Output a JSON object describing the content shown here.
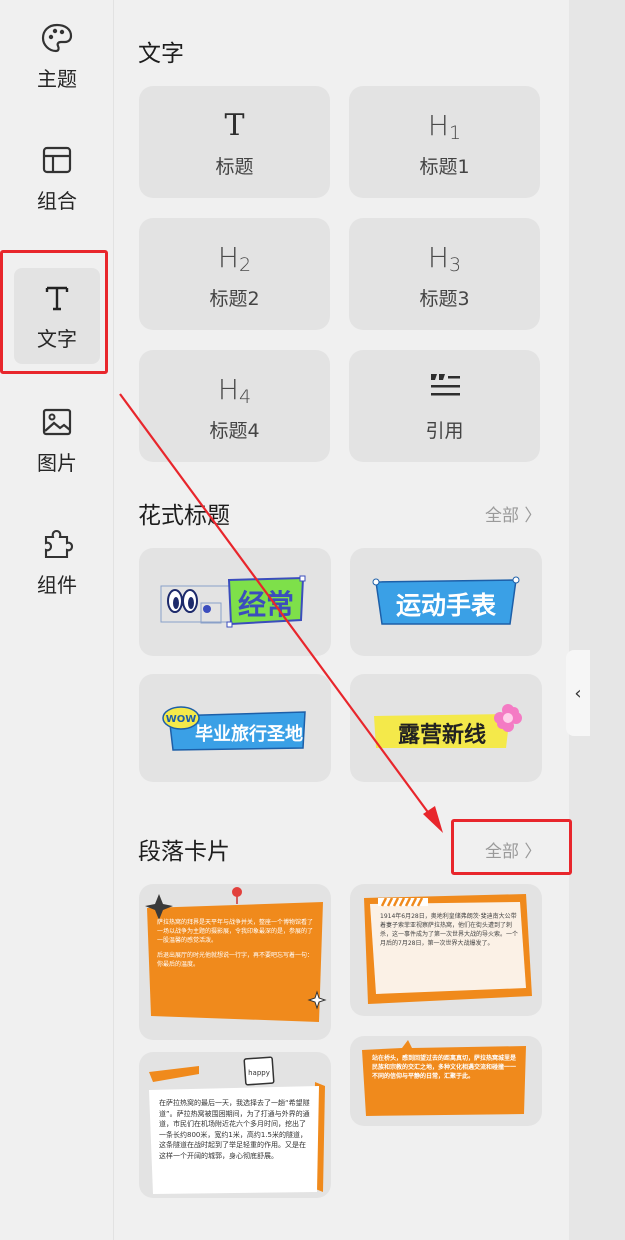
{
  "sidebar": {
    "items": [
      {
        "label": "主题",
        "icon": "palette-icon",
        "active": false
      },
      {
        "label": "组合",
        "icon": "layout-icon",
        "active": false
      },
      {
        "label": "文字",
        "icon": "text-icon",
        "active": true
      },
      {
        "label": "图片",
        "icon": "image-icon",
        "active": false
      },
      {
        "label": "组件",
        "icon": "puzzle-icon",
        "active": false
      }
    ]
  },
  "text_section": {
    "title": "文字",
    "tiles": [
      {
        "glyph": "T",
        "sub": "",
        "label": "标题"
      },
      {
        "glyph": "H",
        "sub": "1",
        "label": "标题1"
      },
      {
        "glyph": "H",
        "sub": "2",
        "label": "标题2"
      },
      {
        "glyph": "H",
        "sub": "3",
        "label": "标题3"
      },
      {
        "glyph": "H",
        "sub": "4",
        "label": "标题4"
      },
      {
        "glyph": "quote",
        "sub": "",
        "label": "引用"
      }
    ]
  },
  "fancy_section": {
    "title": "花式标题",
    "see_all": "全部 〉",
    "items": [
      "经常",
      "运动手表",
      "毕业旅行圣地",
      "露营新线"
    ],
    "wow_badge": "WOW"
  },
  "paragraph_section": {
    "title": "段落卡片",
    "see_all": "全部 〉",
    "card1_text": "萨拉热窝的拜界是天平年与战争并关，整座一个博物馆看了一场以战争为主题的摄影展，令我印象最深的是，参展的了一股温馨的感觉活泼。",
    "card1_text2": "后退出展厅的时光他就想说一行字，再不要吧忘写着一句：你最后的温度。",
    "card2_text": "1914年6月28日，奥地利皇储弗朗茨·斐迪南大公带着妻子索菲亚视察萨拉热窝，他们在街头遭到了刺杀，这一事件成为了第一次世界大战的导火索。一个月后的7月28日，第一次世界大战爆发了。",
    "card3_badge": "happy",
    "card3_text": "在萨拉热窝的最后一天，我选择去了一趟“希望隧道”。萨拉热窝被围困期间，为了打通与外界的通道，市民们在机场附近花六个多月时间，挖出了一条长约800米，宽约1米，高约1.5米的隧道，这条隧道在战时起到了举足轻重的作用。又是在这样一个开阔的城郭，身心彻底舒展。",
    "card4_text": "站在桥头，感到回望过去的距离真切，萨拉热窝城里是民族和宗教的交汇之地，多种文化相遇交流和碰撞一一不同的信仰与平静的日常，汇聚于此。"
  },
  "colors": {
    "accent_red": "#e8262c",
    "orange": "#f08a1c",
    "banner_blue": "#3aa0e6"
  }
}
